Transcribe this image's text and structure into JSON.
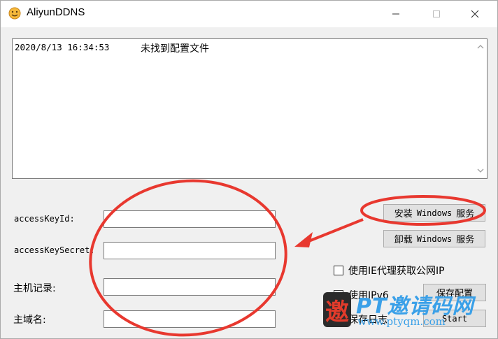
{
  "window": {
    "title": "AliyunDDNS",
    "icon": "smiley-app-icon"
  },
  "log": {
    "entries": [
      {
        "timestamp": "2020/8/13 16:34:53",
        "message": "未找到配置文件"
      }
    ]
  },
  "form": {
    "access_key_id_label": "accessKeyId:",
    "access_key_secret_label": "accessKeySecret:",
    "host_record_label": "主机记录:",
    "domain_label": "主域名:",
    "access_key_id_value": "",
    "access_key_secret_value": "",
    "host_record_value": "",
    "domain_value": ""
  },
  "buttons": {
    "install_prefix": "安装",
    "install_mid": "Windows",
    "install_suffix": "服务",
    "uninstall_prefix": "卸载",
    "uninstall_mid": "Windows",
    "uninstall_suffix": "服务",
    "save_config": "保存配置",
    "start": "Start"
  },
  "options": {
    "use_ie_proxy": "使用IE代理获取公网IP",
    "use_ipv6": "使用IPv6",
    "save_log": "保存日志"
  },
  "watermark": {
    "logo_char": "邀",
    "title": "PT邀请码网",
    "url": "www.ptyqm.com"
  },
  "colors": {
    "annotation_red": "#e8382f",
    "watermark_blue": "#3aa0e8"
  }
}
